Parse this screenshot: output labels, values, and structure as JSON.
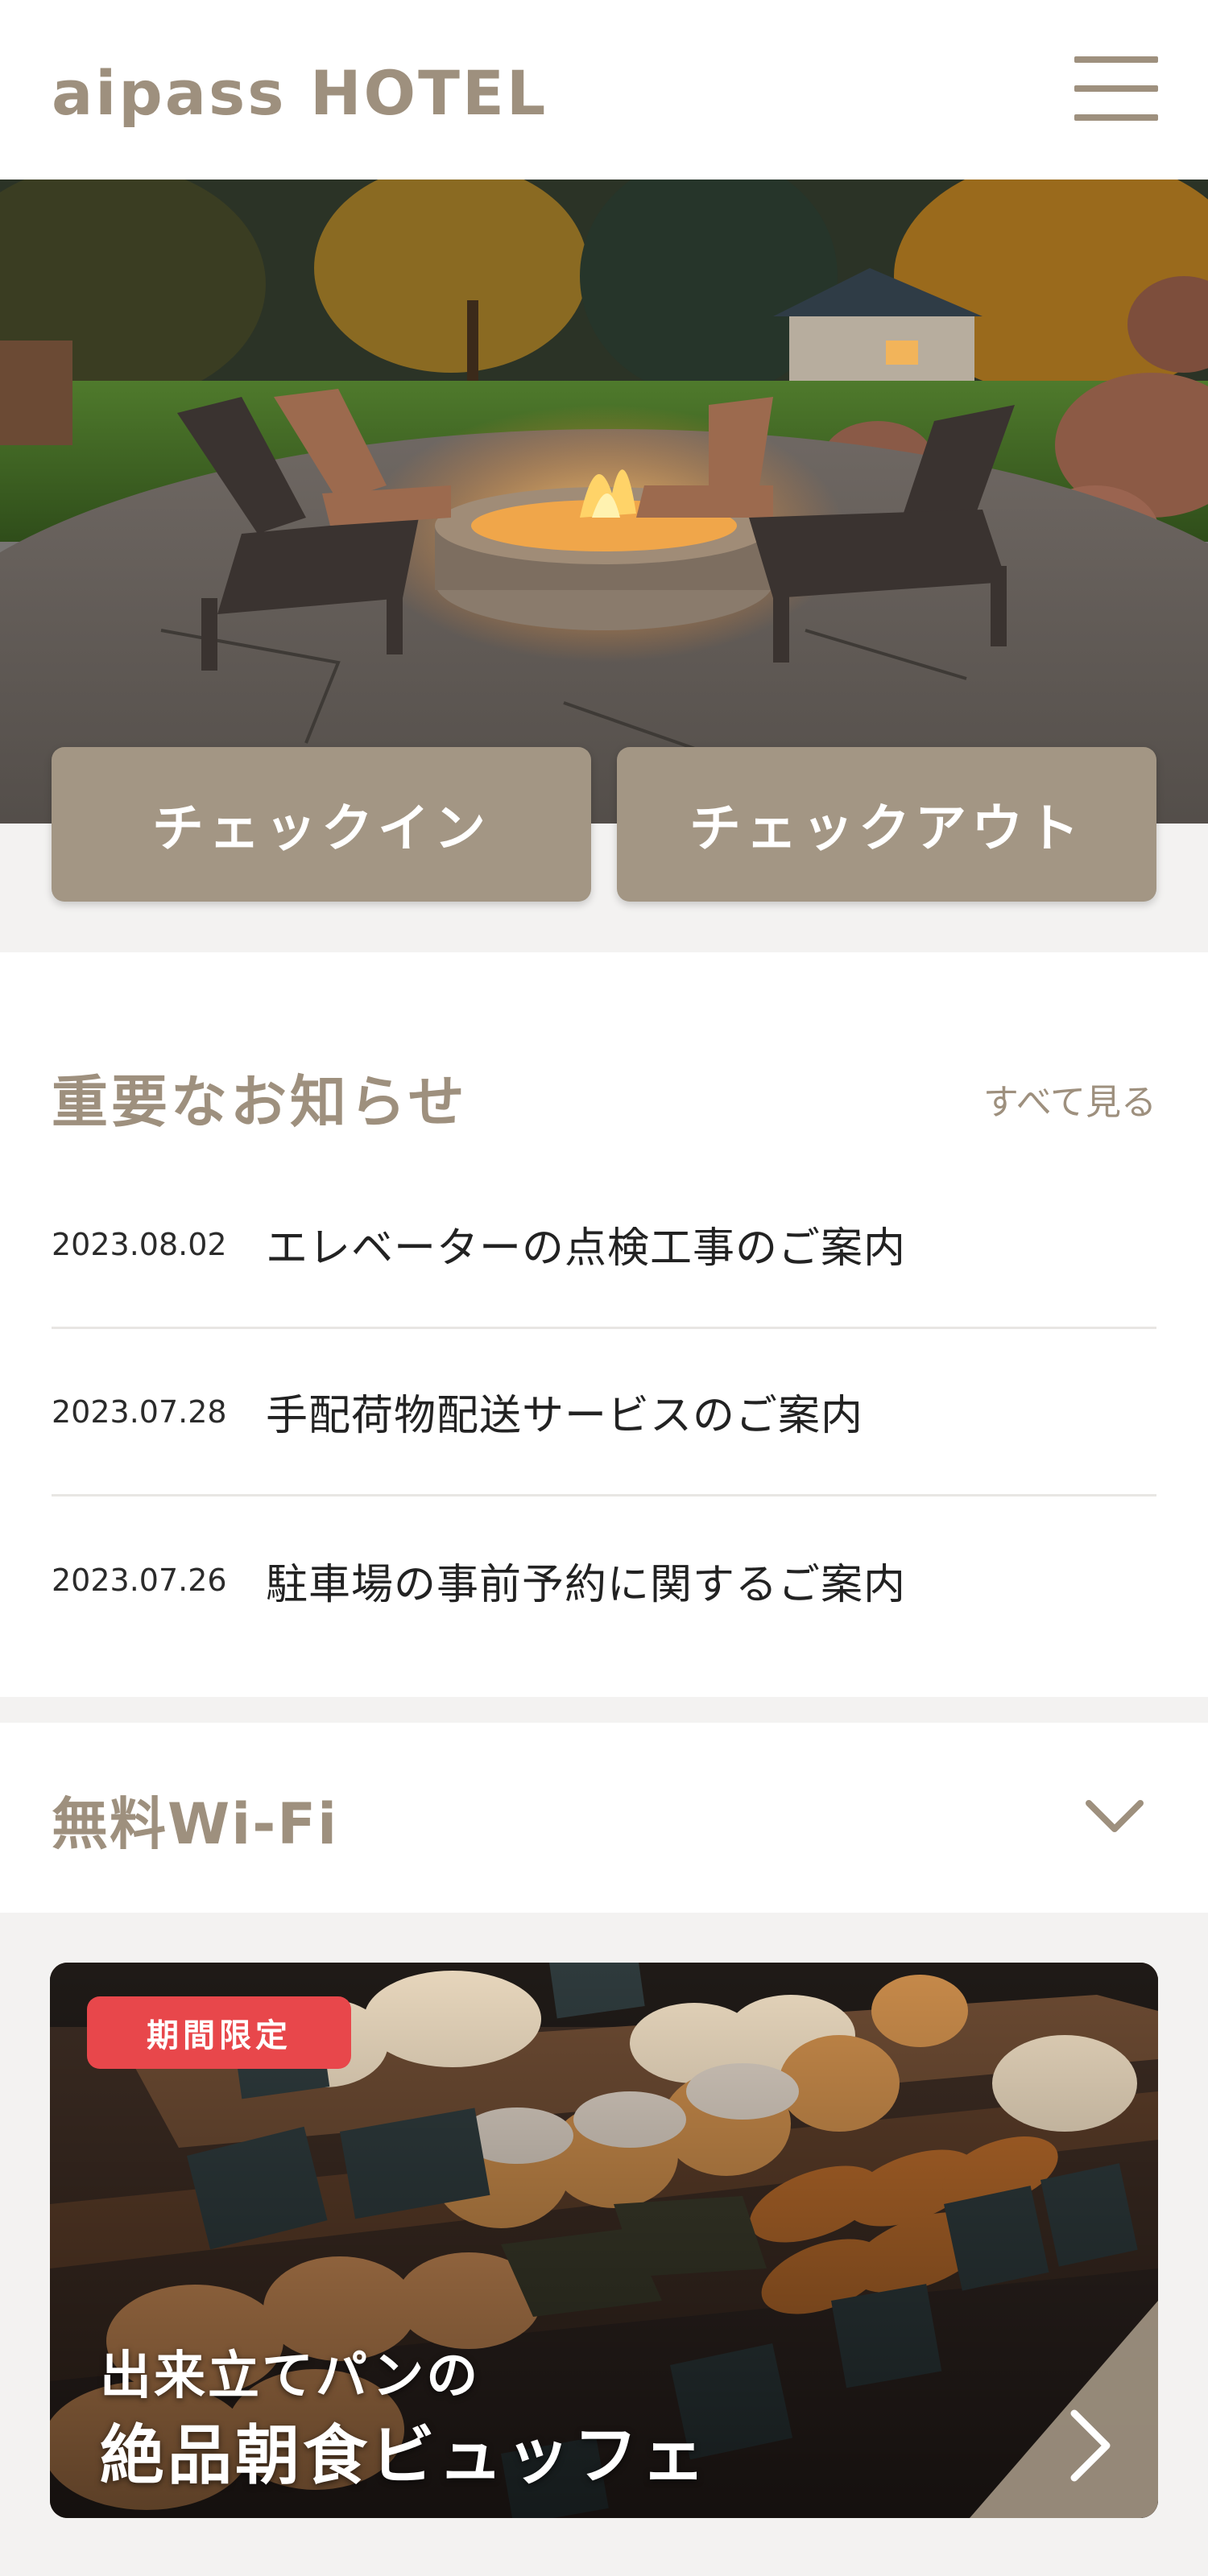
{
  "header": {
    "logo": "aipass HOTEL",
    "menu_icon": "hamburger-menu-icon"
  },
  "hero": {
    "image_subject": "fire pit with wooden chairs in garden at dusk",
    "checkin_label": "チェックイン",
    "checkout_label": "チェックアウト"
  },
  "news": {
    "title": "重要なお知らせ",
    "view_all": "すべて見る",
    "items": [
      {
        "date": "2023.08.02",
        "text": "エレベーターの点検工事のご案内"
      },
      {
        "date": "2023.07.28",
        "text": "手配荷物配送サービスのご案内"
      },
      {
        "date": "2023.07.26",
        "text": "駐車場の事前予約に関するご案内"
      }
    ]
  },
  "wifi": {
    "title": "無料Wi-Fi",
    "icon": "chevron-down-icon"
  },
  "promo": {
    "badge": "期間限定",
    "line1": "出来立てパンの",
    "line2": "絶品朝食ビュッフェ",
    "image_subject": "bakery display with breads and croissants",
    "arrow_icon": "chevron-right-icon"
  },
  "colors": {
    "brand": "#9e907e",
    "button": "#a39684",
    "badge": "#e8474b",
    "background": "#f3f2f1"
  }
}
